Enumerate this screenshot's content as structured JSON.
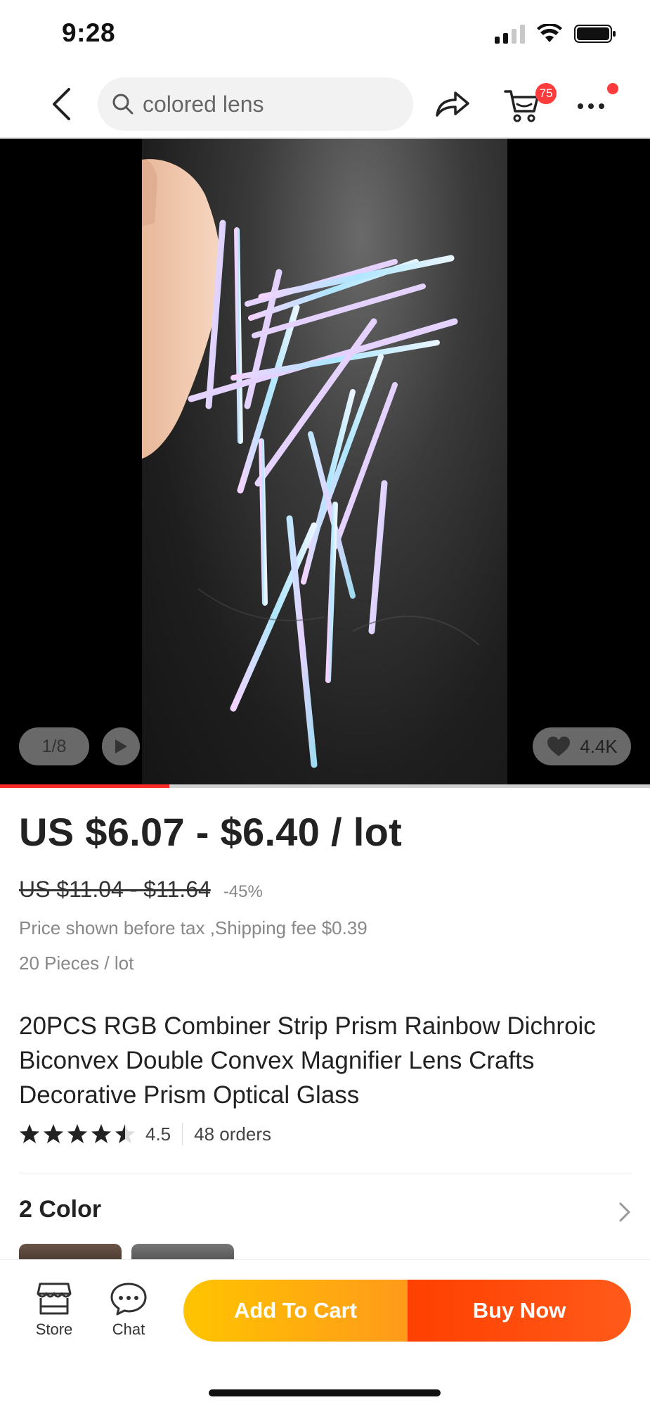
{
  "status_bar": {
    "time": "9:28"
  },
  "top_nav": {
    "search_text": "colored lens",
    "cart_count": "75"
  },
  "media": {
    "counter": "1/8",
    "likes": "4.4K",
    "progress": 0.26
  },
  "product": {
    "price": "US $6.07 - $6.40 / lot",
    "original_price": "US $11.04 - $11.64",
    "discount": "-45%",
    "tax_note": "Price shown before tax ,Shipping fee $0.39",
    "pieces": "20 Pieces / lot",
    "title": "20PCS RGB Combiner Strip Prism Rainbow Dichroic Biconvex Double Convex Magnifier Lens Crafts Decorative Prism Optical Glass",
    "rating": "4.5",
    "rating_value": 4.5,
    "orders": "48 orders"
  },
  "variants": {
    "title": "2 Color"
  },
  "bottom_bar": {
    "store_label": "Store",
    "chat_label": "Chat",
    "add_to_cart_label": "Add To Cart",
    "buy_now_label": "Buy Now"
  },
  "colors": {
    "accent_red": "#ff3b3b",
    "cart_button": "#ffb000",
    "buy_button": "#ff4a0a"
  }
}
